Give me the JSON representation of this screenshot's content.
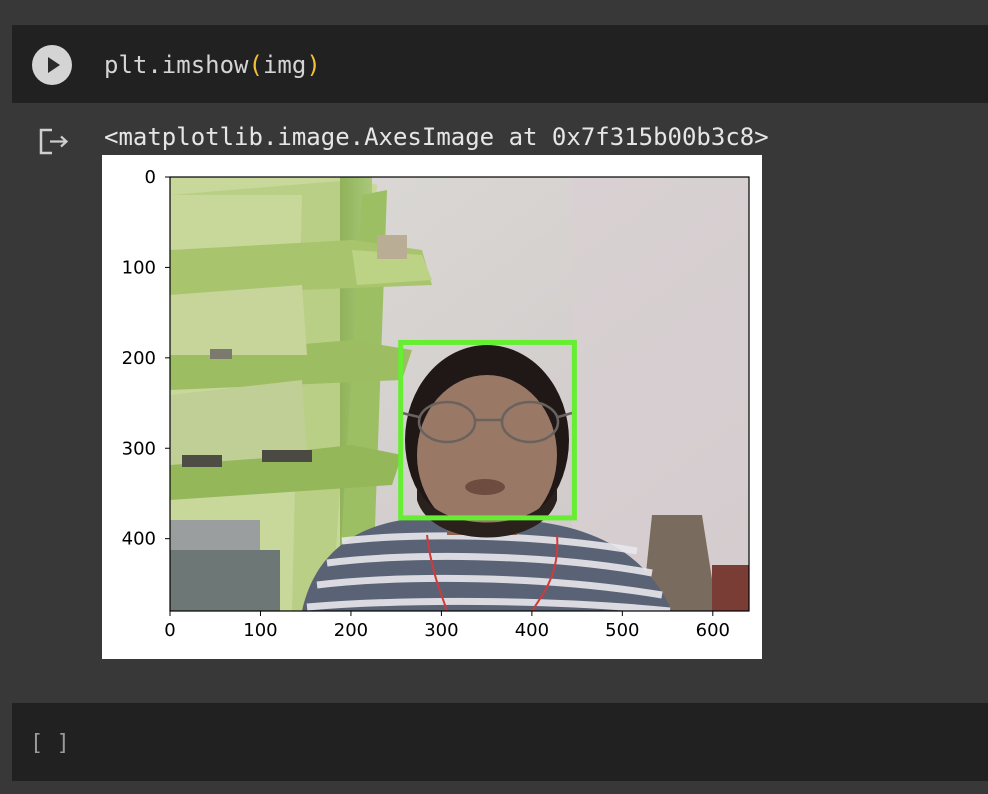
{
  "code_cell": {
    "code_prefix": "plt.imshow",
    "paren_open": "(",
    "code_arg": "img",
    "paren_close": ")"
  },
  "output": {
    "text": "<matplotlib.image.AxesImage at 0x7f315b00b3c8>",
    "icon": "output-redirect-icon"
  },
  "chart_data": {
    "type": "image",
    "xlim": [
      0,
      640
    ],
    "ylim": [
      480,
      0
    ],
    "xticks": [
      0,
      100,
      200,
      300,
      400,
      500,
      600
    ],
    "yticks": [
      0,
      100,
      200,
      300,
      400
    ],
    "xtick_labels": [
      "0",
      "100",
      "200",
      "300",
      "400",
      "500",
      "600"
    ],
    "ytick_labels": [
      "0",
      "100",
      "200",
      "300",
      "400"
    ],
    "xlabel": "",
    "ylabel": "",
    "title": "",
    "annotation": {
      "type": "rectangle",
      "x0": 255,
      "y0": 183,
      "x1": 447,
      "y1": 377,
      "color": "#66ee33"
    }
  },
  "empty_cell": {
    "prompt": "[ ]"
  },
  "colors": {
    "page_bg": "#383838",
    "cell_bg": "#212121",
    "code_text": "#d4d4d4",
    "paren": "#f1c232",
    "box": "#66ee33"
  }
}
